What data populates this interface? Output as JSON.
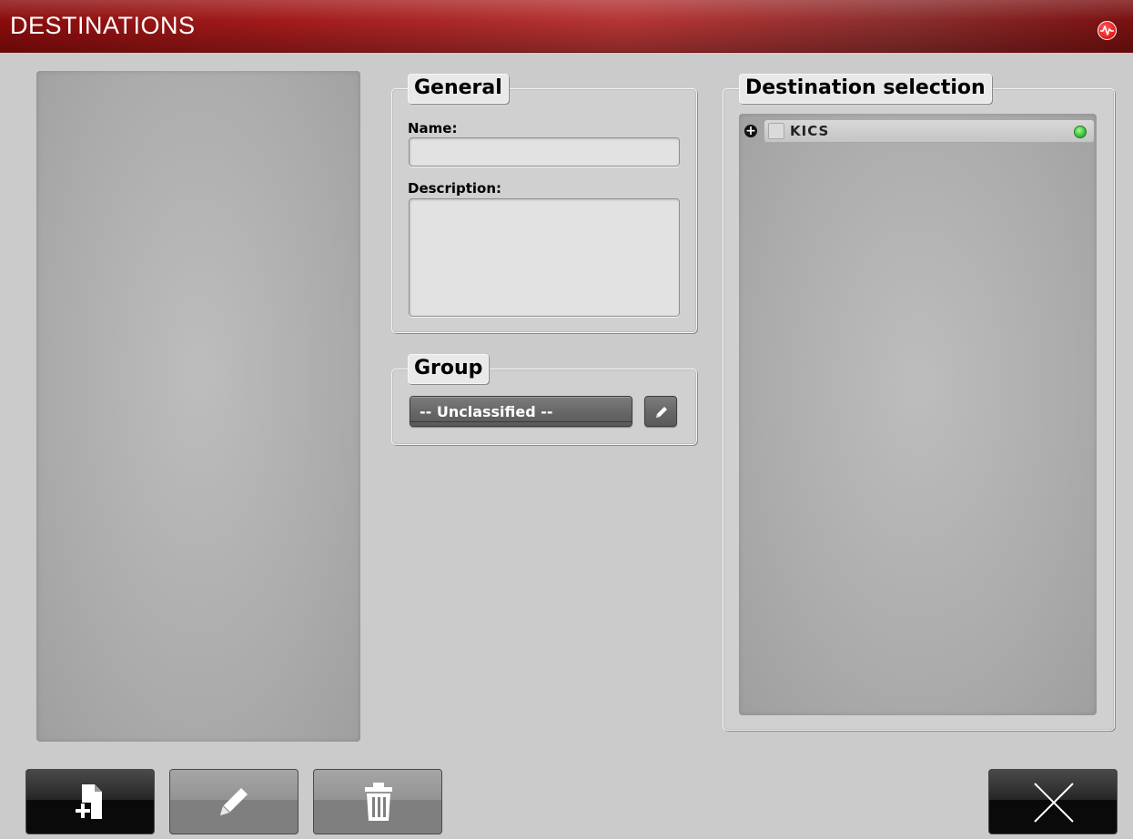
{
  "window": {
    "title": "DESTINATIONS",
    "status_icon": "waveform-icon",
    "accent_color": "#a21b1b"
  },
  "general": {
    "legend": "General",
    "name_label": "Name:",
    "name_value": "",
    "description_label": "Description:",
    "description_value": ""
  },
  "group": {
    "legend": "Group",
    "selected": "-- Unclassified --",
    "edit_icon": "pencil-icon"
  },
  "destination_selection": {
    "legend": "Destination selection",
    "items": [
      {
        "name": "KICS",
        "checked": false,
        "expanded": false,
        "status": "online",
        "status_color": "#2db32d"
      }
    ]
  },
  "toolbar": {
    "add_icon": "add-document-icon",
    "edit_icon": "pencil-icon",
    "delete_icon": "trash-icon",
    "close_icon": "close-icon"
  }
}
